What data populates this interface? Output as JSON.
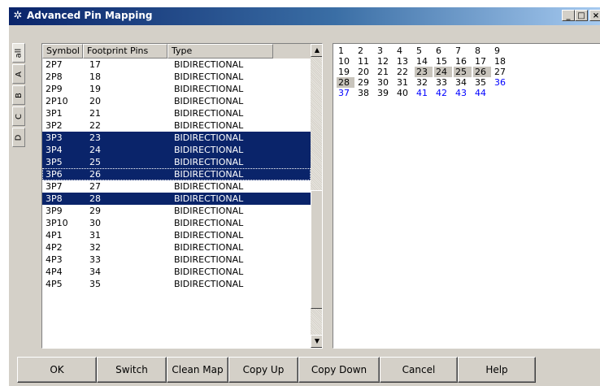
{
  "window": {
    "title": "Advanced Pin Mapping"
  },
  "title_buttons": [
    "_",
    "□",
    "×"
  ],
  "side_tabs": [
    "all",
    "A",
    "B",
    "C",
    "D"
  ],
  "grid": {
    "columns": [
      "Symbol Pins",
      "Footprint Pins",
      "Type"
    ],
    "rows": [
      {
        "symbol": "2P7",
        "footprint": "17",
        "type": "BIDIRECTIONAL",
        "selected": false
      },
      {
        "symbol": "2P8",
        "footprint": "18",
        "type": "BIDIRECTIONAL",
        "selected": false
      },
      {
        "symbol": "2P9",
        "footprint": "19",
        "type": "BIDIRECTIONAL",
        "selected": false
      },
      {
        "symbol": "2P10",
        "footprint": "20",
        "type": "BIDIRECTIONAL",
        "selected": false
      },
      {
        "symbol": "3P1",
        "footprint": "21",
        "type": "BIDIRECTIONAL",
        "selected": false
      },
      {
        "symbol": "3P2",
        "footprint": "22",
        "type": "BIDIRECTIONAL",
        "selected": false
      },
      {
        "symbol": "3P3",
        "footprint": "23",
        "type": "BIDIRECTIONAL",
        "selected": true
      },
      {
        "symbol": "3P4",
        "footprint": "24",
        "type": "BIDIRECTIONAL",
        "selected": true
      },
      {
        "symbol": "3P5",
        "footprint": "25",
        "type": "BIDIRECTIONAL",
        "selected": true
      },
      {
        "symbol": "3P6",
        "footprint": "26",
        "type": "BIDIRECTIONAL",
        "selected": true,
        "focused": true
      },
      {
        "symbol": "3P7",
        "footprint": "27",
        "type": "BIDIRECTIONAL",
        "selected": false
      },
      {
        "symbol": "3P8",
        "footprint": "28",
        "type": "BIDIRECTIONAL",
        "selected": true
      },
      {
        "symbol": "3P9",
        "footprint": "29",
        "type": "BIDIRECTIONAL",
        "selected": false
      },
      {
        "symbol": "3P10",
        "footprint": "30",
        "type": "BIDIRECTIONAL",
        "selected": false
      },
      {
        "symbol": "4P1",
        "footprint": "31",
        "type": "BIDIRECTIONAL",
        "selected": false
      },
      {
        "symbol": "4P2",
        "footprint": "32",
        "type": "BIDIRECTIONAL",
        "selected": false
      },
      {
        "symbol": "4P3",
        "footprint": "33",
        "type": "BIDIRECTIONAL",
        "selected": false
      },
      {
        "symbol": "4P4",
        "footprint": "34",
        "type": "BIDIRECTIONAL",
        "selected": false
      },
      {
        "symbol": "4P5",
        "footprint": "35",
        "type": "BIDIRECTIONAL",
        "selected": false
      }
    ]
  },
  "scrollbar": {
    "up_arrow": "▲",
    "down_arrow": "▼"
  },
  "footprint_map": {
    "pins": [
      {
        "n": "1",
        "state": "normal"
      },
      {
        "n": "2",
        "state": "normal"
      },
      {
        "n": "3",
        "state": "normal"
      },
      {
        "n": "4",
        "state": "normal"
      },
      {
        "n": "5",
        "state": "normal"
      },
      {
        "n": "6",
        "state": "normal"
      },
      {
        "n": "7",
        "state": "normal"
      },
      {
        "n": "8",
        "state": "normal"
      },
      {
        "n": "9",
        "state": "normal"
      },
      {
        "n": "10",
        "state": "normal"
      },
      {
        "n": "11",
        "state": "normal"
      },
      {
        "n": "12",
        "state": "normal"
      },
      {
        "n": "13",
        "state": "normal"
      },
      {
        "n": "14",
        "state": "normal"
      },
      {
        "n": "15",
        "state": "normal"
      },
      {
        "n": "16",
        "state": "normal"
      },
      {
        "n": "17",
        "state": "normal"
      },
      {
        "n": "18",
        "state": "normal"
      },
      {
        "n": "19",
        "state": "normal"
      },
      {
        "n": "20",
        "state": "normal"
      },
      {
        "n": "21",
        "state": "normal"
      },
      {
        "n": "22",
        "state": "normal"
      },
      {
        "n": "23",
        "state": "highlighted"
      },
      {
        "n": "24",
        "state": "highlighted"
      },
      {
        "n": "25",
        "state": "highlighted"
      },
      {
        "n": "26",
        "state": "highlighted"
      },
      {
        "n": "27",
        "state": "normal"
      },
      {
        "n": "28",
        "state": "highlighted"
      },
      {
        "n": "29",
        "state": "normal"
      },
      {
        "n": "30",
        "state": "normal"
      },
      {
        "n": "31",
        "state": "normal"
      },
      {
        "n": "32",
        "state": "normal"
      },
      {
        "n": "33",
        "state": "normal"
      },
      {
        "n": "34",
        "state": "normal"
      },
      {
        "n": "35",
        "state": "normal"
      },
      {
        "n": "36",
        "state": "unmapped"
      },
      {
        "n": "37",
        "state": "unmapped"
      },
      {
        "n": "38",
        "state": "normal"
      },
      {
        "n": "39",
        "state": "normal"
      },
      {
        "n": "40",
        "state": "normal"
      },
      {
        "n": "41",
        "state": "unmapped"
      },
      {
        "n": "42",
        "state": "unmapped"
      },
      {
        "n": "43",
        "state": "unmapped"
      },
      {
        "n": "44",
        "state": "unmapped"
      }
    ]
  },
  "buttons": {
    "ok": "OK",
    "switch": "Switch",
    "clean_map": "Clean Map",
    "copy_up": "Copy Up",
    "copy_down": "Copy Down",
    "cancel": "Cancel",
    "help": "Help"
  },
  "colors": {
    "selection": "#0a246a",
    "highlight_pin": "#c8c4bc",
    "unmapped_pin": "#0000ff",
    "face": "#d4d0c8"
  }
}
